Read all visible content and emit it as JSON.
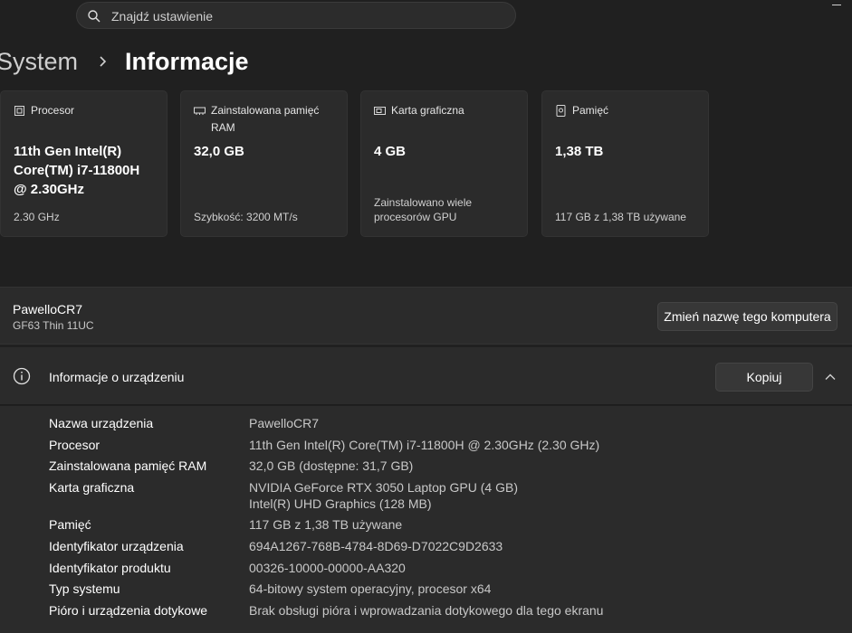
{
  "search": {
    "placeholder": "Znajdź ustawienie"
  },
  "breadcrumb": {
    "parent": "System",
    "current": "Informacje"
  },
  "cards": [
    {
      "label": "Procesor",
      "value": "11th Gen Intel(R) Core(TM) i7-11800H @ 2.30GHz",
      "sub": "2.30 GHz",
      "icon": "processor-icon"
    },
    {
      "label": "Zainstalowana pamięć RAM",
      "value": "32,0 GB",
      "sub": "Szybkość: 3200 MT/s",
      "icon": "ram-icon"
    },
    {
      "label": "Karta graficzna",
      "value": "4 GB",
      "sub": "Zainstalowano wiele procesorów GPU",
      "icon": "graphics-card-icon"
    },
    {
      "label": "Pamięć",
      "value": "1,38 TB",
      "sub": "117 GB z 1,38 TB używane",
      "icon": "storage-icon"
    }
  ],
  "pc": {
    "name": "PawelloCR7",
    "model": "GF63 Thin 11UC",
    "rename_label": "Zmień nazwę tego komputera"
  },
  "device_info": {
    "title": "Informacje o urządzeniu",
    "copy_label": "Kopiuj",
    "rows": [
      {
        "key": "Nazwa urządzenia",
        "value": "PawelloCR7"
      },
      {
        "key": "Procesor",
        "value": "11th Gen Intel(R) Core(TM) i7-11800H @ 2.30GHz   (2.30 GHz)"
      },
      {
        "key": "Zainstalowana pamięć RAM",
        "value": "32,0 GB (dostępne: 31,7 GB)"
      },
      {
        "key": "Karta graficzna",
        "value": "NVIDIA GeForce RTX 3050 Laptop GPU (4 GB)\nIntel(R) UHD Graphics (128 MB)"
      },
      {
        "key": "Pamięć",
        "value": "117 GB z 1,38 TB używane"
      },
      {
        "key": "Identyfikator urządzenia",
        "value": "694A1267-768B-4784-8D69-D7022C9D2633"
      },
      {
        "key": "Identyfikator produktu",
        "value": "00326-10000-00000-AA320"
      },
      {
        "key": "Typ systemu",
        "value": "64-bitowy system operacyjny, procesor x64"
      },
      {
        "key": "Pióro i urządzenia dotykowe",
        "value": "Brak obsługi pióra i wprowadzania dotykowego dla tego ekranu"
      }
    ]
  }
}
